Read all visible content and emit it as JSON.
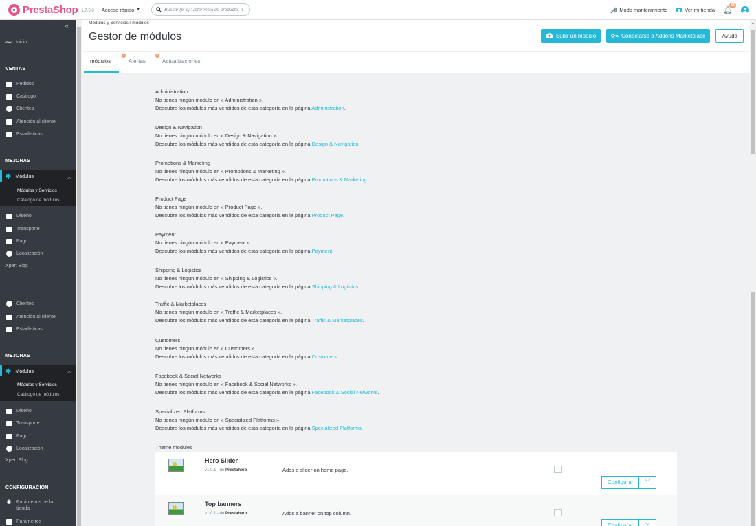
{
  "topbar": {
    "logo_text": "PrestaShop",
    "version": "1.7.5.0",
    "quick_access": "Acceso rápido",
    "search_placeholder": "Buscar (p. ej.: referencia de producto, n",
    "maintenance": "Modo mantenimiento",
    "view_store": "Ver mi tienda",
    "notifications_count": "56"
  },
  "sidebar": {
    "home": "Inicio",
    "sections": [
      {
        "title": "VENTAS"
      },
      {
        "title": "MEJORAS"
      },
      {
        "title": "MEJORAS"
      },
      {
        "title": "CONFIGURACIÓN"
      }
    ],
    "sales_items": [
      "Pedidos",
      "Catálogo",
      "Clientes",
      "Atención al cliente",
      "Estadísticas"
    ],
    "modules_label": "Módulos",
    "modules_sub": [
      "Módulos y Servicios",
      "Catálogo de módulos"
    ],
    "improve_items": [
      "Diseño",
      "Transporte",
      "Pago",
      "Localización",
      "Xpert Blog"
    ],
    "overlap_items": [
      "Clientes",
      "Atención al cliente",
      "Estadísticas"
    ],
    "config_items": [
      "Parámetros de la tienda",
      "Parámetros"
    ]
  },
  "header": {
    "breadcrumb": "Módulos y Servicios  /  módulos",
    "title": "Gestor de módulos",
    "upload_button": "Subir un módulo",
    "connect_button": "Conectarse a Addons Marketplace",
    "help_button": "Ayuda",
    "tabs": [
      {
        "label": "módulos",
        "badge": ""
      },
      {
        "label": "Alertas",
        "badge": "1"
      },
      {
        "label": "Actualizaciones",
        "badge": "5"
      }
    ]
  },
  "categories": [
    {
      "name": "Administration",
      "none": "No tienes ningún módulo en « Administration ».",
      "desc": "Descubre los módulos más vendidos de esta categoría en la página ",
      "link": "Administration"
    },
    {
      "name": "Design & Navigation",
      "none": "No tienes ningún módulo en « Design & Navigation ».",
      "desc": "Descubre los módulos más vendidos de esta categoría en la página ",
      "link": "Design & Navigation"
    },
    {
      "name": "Promotions & Marketing",
      "none": "No tienes ningún módulo en « Promotions & Marketing ».",
      "desc": "Descubre los módulos más vendidos de esta categoría en la página ",
      "link": "Promotions & Marketing"
    },
    {
      "name": "Product Page",
      "none": "No tienes ningún módulo en « Product Page ».",
      "desc": "Descubre los módulos más vendidos de esta categoría en la página ",
      "link": "Product Page"
    },
    {
      "name": "Payment",
      "none": "No tienes ningún módulo en « Payment ».",
      "desc": "Descubre los módulos más vendidos de esta categoría en la página ",
      "link": "Payment"
    },
    {
      "name": "Shipping & Logistics",
      "none": "No tienes ningún módulo en « Shipping & Logistics ».",
      "desc": "Descubre los módulos más vendidos de esta categoría en la página ",
      "link": "Shipping & Logistics"
    },
    {
      "name": "Traffic & Marketplaces",
      "none": "No tienes ningún módulo en « Traffic & Marketplaces ».",
      "desc": "Descubre los módulos más vendidos de esta categoría en la página ",
      "link": "Traffic & Marketplaces"
    },
    {
      "name": "Customers",
      "none": "No tienes ningún módulo en « Customers ».",
      "desc": "Descubre los módulos más vendidos de esta categoría en la página ",
      "link": "Customers"
    },
    {
      "name": "Facebook & Social Networks",
      "none": "No tienes ningún módulo en « Facebook & Social Networks ».",
      "desc": "Descubre los módulos más vendidos de esta categoría en la página ",
      "link": "Facebook & Social Networks"
    },
    {
      "name": "Specialized Platforms",
      "none": "No tienes ningún módulo en « Specialized Platforms ».",
      "desc": "Descubre los módulos más vendidos de esta categoría en la página ",
      "link": "Specialized Platforms"
    }
  ],
  "theme_modules": {
    "title": "Theme modules",
    "modules": [
      {
        "name": "Hero Slider",
        "version": "v1.0.1 - de",
        "author": "Prestahero",
        "desc": "Adds a slider on home page.",
        "configure": "Configurar"
      },
      {
        "name": "Top banners",
        "version": "v1.0.1 - de",
        "author": "Prestahero",
        "desc": "Adds a banner on top column.",
        "configure": "Configurar"
      }
    ]
  },
  "colors": {
    "accent": "#25b9d7",
    "brand": "#e8538b",
    "sidebar": "#363a41",
    "badge": "#f39d72"
  }
}
